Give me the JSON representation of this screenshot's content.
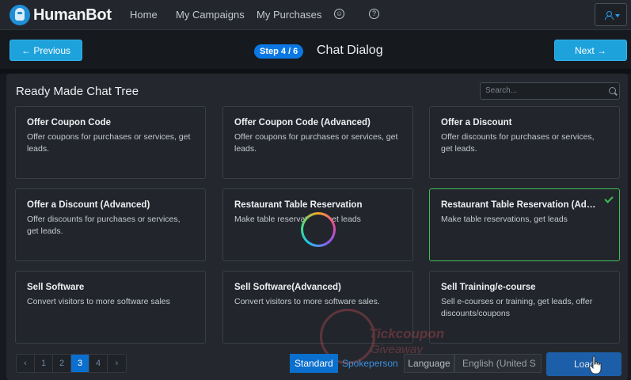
{
  "app": {
    "logo_text": "HumanBot",
    "nav": [
      "Home",
      "My Campaigns",
      "My Purchases"
    ],
    "nav_icons": [
      "support-icon",
      "help-icon"
    ],
    "user_icon": "user-icon"
  },
  "stepbar": {
    "previous_label": "← Previous",
    "next_label": "Next →",
    "step_badge": "Step 4 / 6",
    "step_title": "Chat Dialog"
  },
  "panel": {
    "title": "Ready Made Chat Tree",
    "search_placeholder": "Search...",
    "cards": [
      {
        "title": "Offer Coupon Code",
        "desc": "Offer coupons for purchases or services, get leads."
      },
      {
        "title": "Offer Coupon Code (Advanced)",
        "desc": "Offer coupons for purchases or services, get leads."
      },
      {
        "title": "Offer a Discount",
        "desc": "Offer discounts for purchases or services, get leads."
      },
      {
        "title": "Offer a Discount (Advanced)",
        "desc": "Offer discounts for purchases or services, get leads."
      },
      {
        "title": "Restaurant Table Reservation",
        "desc": "Make table reservations, get leads"
      },
      {
        "title": "Restaurant Table Reservation (Advanced)",
        "desc": "Make table reservations, get leads",
        "selected": true
      },
      {
        "title": "Sell Software",
        "desc": "Convert visitors to more software sales"
      },
      {
        "title": "Sell Software(Advanced)",
        "desc": "Convert visitors to more software sales."
      },
      {
        "title": "Sell Training/e-course",
        "desc": "Sell e-courses or training, get leads, offer discounts/coupons"
      }
    ]
  },
  "footer": {
    "pager": [
      "‹",
      "1",
      "2",
      "3",
      "4",
      "›"
    ],
    "pager_active": "3",
    "standard_label": "Standard",
    "spokesperson_label": "Spokeperson",
    "language_label": "Language",
    "language_value": "English (United S",
    "load_label": "Load"
  },
  "watermark": {
    "line1": "Tickcoupon",
    "line2": "Giveaway"
  },
  "colors": {
    "accent": "#1ea2dc",
    "step_badge": "#0b78e3",
    "selected_border": "#3dbf55",
    "load_button": "#1c5fa8"
  }
}
